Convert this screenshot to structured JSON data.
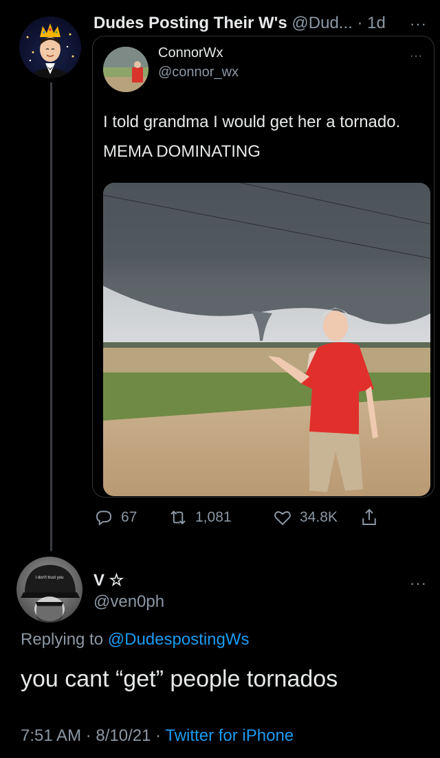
{
  "thread_tweet": {
    "author_name": "Dudes Posting Their W's",
    "author_handle": "@Dud...",
    "separator": "·",
    "age": "1d",
    "more_label": "···"
  },
  "quoted_tweet": {
    "author_name": "ConnorWx",
    "author_handle": "@connor_wx",
    "more_label": "···",
    "text": "I told grandma I would get her a tornado. MEMA DOMINATING"
  },
  "actions": {
    "replies": "67",
    "retweets": "1,081",
    "likes": "34.8K"
  },
  "reply_tweet": {
    "author_name": "V ☆",
    "author_handle": "@ven0ph",
    "more_label": "···",
    "replying_prefix": "Replying to",
    "replying_to": "@DudespostingWs",
    "text": "you cant “get” people tornados",
    "time": "7:51 AM",
    "separator": "·",
    "date": "8/10/21",
    "source": "Twitter for iPhone",
    "avatar_cap_text": "I don't trust you"
  },
  "colors": {
    "background": "#000000",
    "text": "#e7e9ea",
    "muted": "#8b98a5",
    "link": "#1d9bf0",
    "border": "#2f3336"
  }
}
